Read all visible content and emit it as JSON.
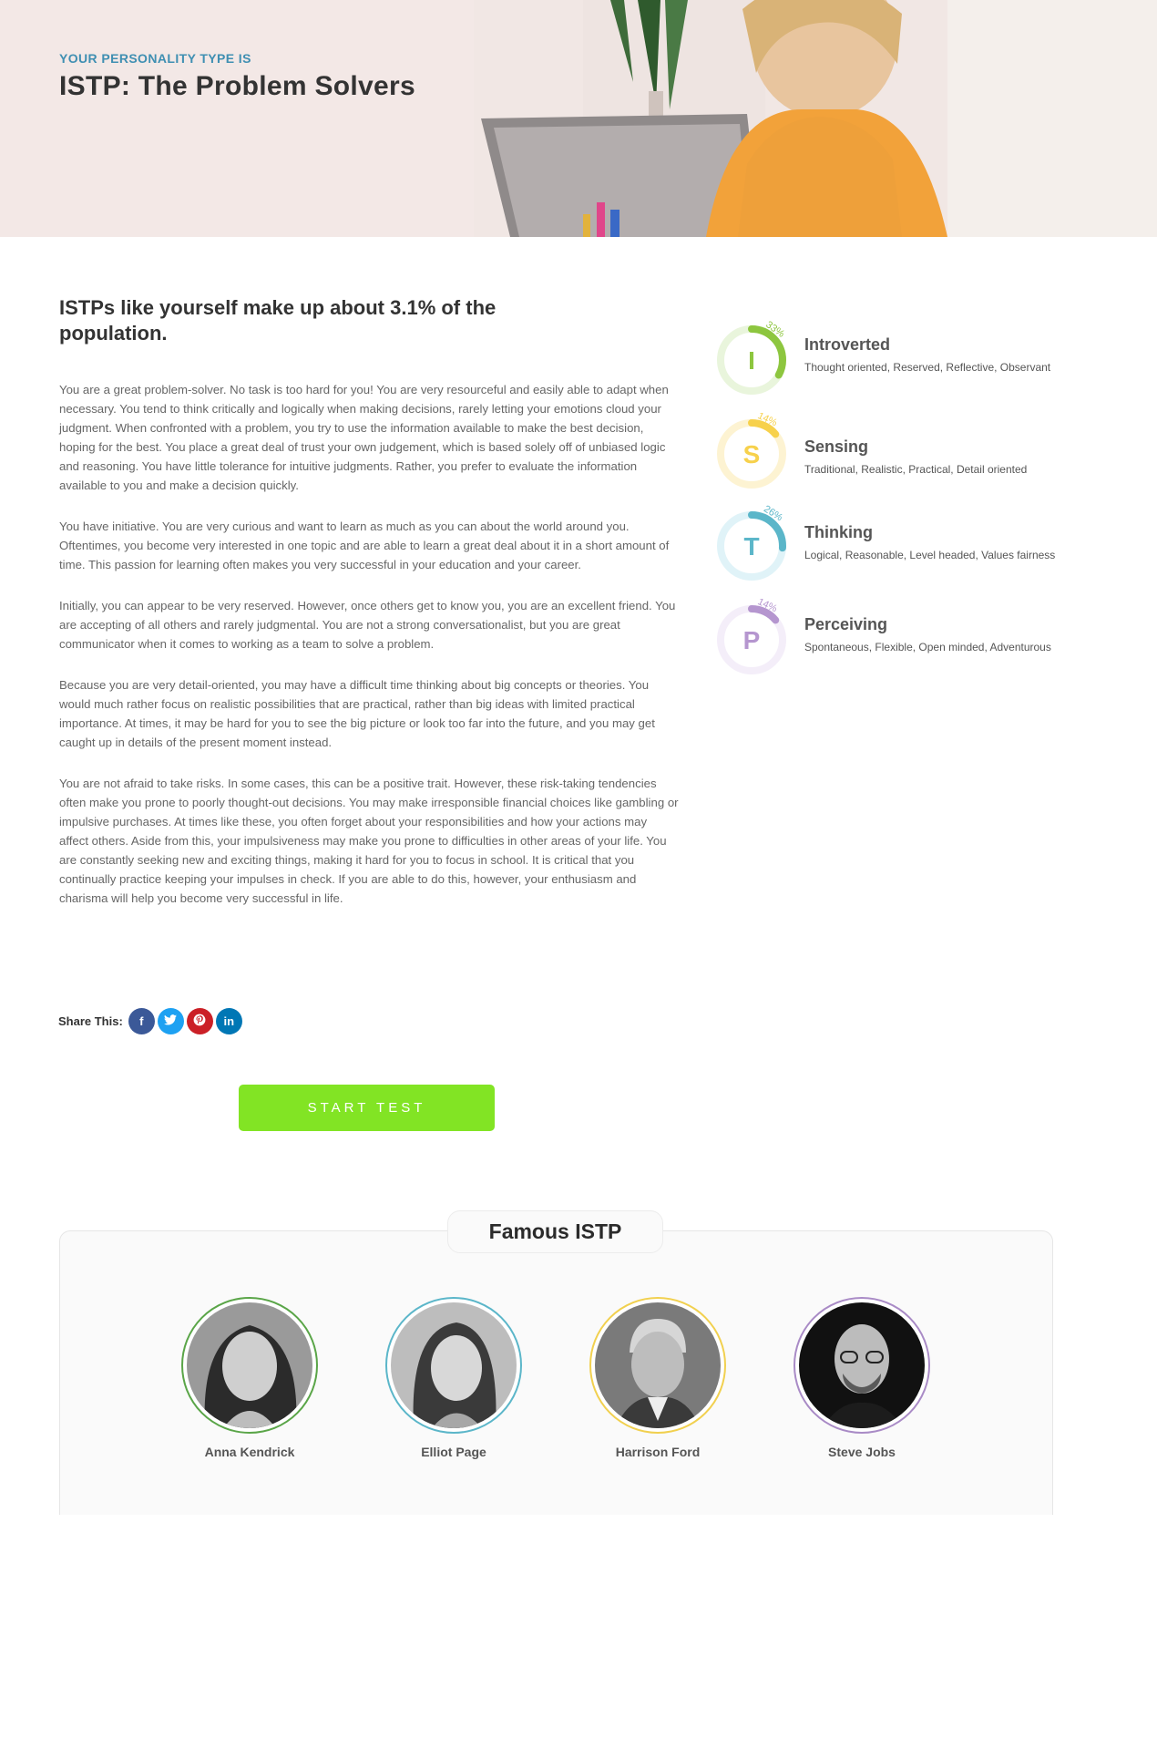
{
  "hero": {
    "eyebrow": "YOUR PERSONALITY TYPE IS",
    "title": "ISTP: The Problem Solvers"
  },
  "headline": "ISTPs like yourself make up about 3.1% of the population.",
  "paragraphs": [
    "You are a great problem-solver. No task is too hard for you! You are very resourceful and easily able to adapt when necessary. You tend to think critically and logically when making decisions, rarely letting your emotions cloud your judgment. When confronted with a problem, you try to use the information available to make the best decision, hoping for the best. You place a great deal of trust your own judgement, which is based solely off of unbiased logic and reasoning. You have little tolerance for intuitive judgments. Rather, you prefer to evaluate the information available to you and make a decision quickly.",
    "You have initiative. You are very curious and want to learn as much as you can about the world around you. Oftentimes, you become very interested in one topic and are able to learn a great deal about it in a short amount of time. This passion for learning often makes you very successful in your education and your career.",
    "Initially, you can appear to be very reserved. However, once others get to know you, you are an excellent friend. You are accepting of all others and rarely judgmental. You are not a strong conversationalist, but you are great communicator when it comes to working as a team to solve a problem.",
    "Because you are very detail-oriented, you may have a difficult time thinking about big concepts or theories. You would much rather focus on realistic possibilities that are practical, rather than big ideas with limited practical importance. At times, it may be hard for you to see the big picture or look too far into the future, and you may get caught up in details of the present moment instead.",
    "You are not afraid to take risks. In some cases, this can be a positive trait. However, these risk-taking tendencies often make you prone to poorly thought-out decisions. You may make irresponsible financial choices like gambling or impulsive purchases. At times like these, you often forget about your responsibilities and how your actions may affect others. Aside from this, your impulsiveness may make you prone to difficulties in other areas of your life. You are constantly seeking new and exciting things, making it hard for you to focus in school. It is critical that you continually practice keeping your impulses in check. If you are able to do this, however, your enthusiasm and charisma will help you become very successful in life."
  ],
  "share": {
    "label": "Share This:",
    "buttons": [
      {
        "name": "facebook",
        "glyph": "f"
      },
      {
        "name": "twitter",
        "glyph": "t"
      },
      {
        "name": "pinterest",
        "glyph": "p"
      },
      {
        "name": "linkedin",
        "glyph": "in"
      }
    ]
  },
  "start_button": "START TEST",
  "traits": [
    {
      "letter": "I",
      "name": "Introverted",
      "percent": 33,
      "percent_label": "33%",
      "color": "#8dc63f",
      "track": "#e9f5dc",
      "desc": "Thought oriented, Reserved, Reflective, Observant"
    },
    {
      "letter": "S",
      "name": "Sensing",
      "percent": 14,
      "percent_label": "14%",
      "color": "#f7d14c",
      "track": "#fdf3d2",
      "desc": "Traditional, Realistic, Practical, Detail oriented"
    },
    {
      "letter": "T",
      "name": "Thinking",
      "percent": 26,
      "percent_label": "26%",
      "color": "#5bb6c9",
      "track": "#e0f3f8",
      "desc": "Logical, Reasonable, Level headed, Values fairness"
    },
    {
      "letter": "P",
      "name": "Perceiving",
      "percent": 14,
      "percent_label": "14%",
      "color": "#b596cf",
      "track": "#f4eef9",
      "desc": "Spontaneous, Flexible, Open minded, Adventurous"
    }
  ],
  "famous": {
    "title": "Famous ISTP",
    "people": [
      {
        "name": "Anna Kendrick",
        "ring": "#5aa548"
      },
      {
        "name": "Elliot Page",
        "ring": "#5bb6c9"
      },
      {
        "name": "Harrison Ford",
        "ring": "#f1d04f"
      },
      {
        "name": "Steve Jobs",
        "ring": "#a98bc6"
      }
    ]
  }
}
